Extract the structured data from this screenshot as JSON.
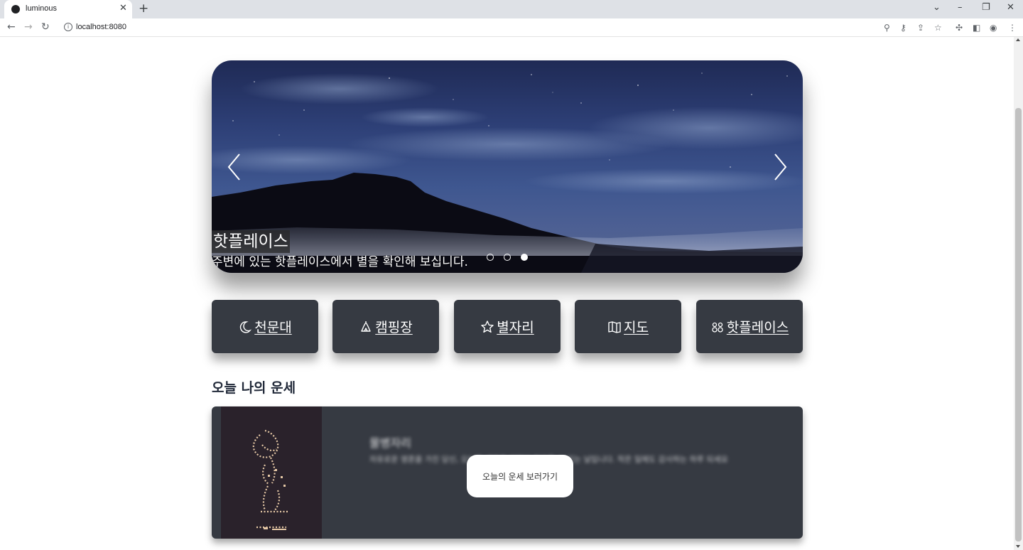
{
  "browser": {
    "tab_title": "luminous",
    "url": "localhost:8080",
    "tab_close": "✕",
    "new_tab": "+",
    "info_glyph": "i"
  },
  "carousel": {
    "caption_title": "핫플레이스",
    "caption_subtitle": "주변에 있는 핫플레이스에서 별을 확인해 보십니다.",
    "slide_count": 3,
    "active_slide": 3
  },
  "categories": [
    {
      "label": "천문대",
      "icon": "moon-icon"
    },
    {
      "label": "캠핑장",
      "icon": "tent-icon"
    },
    {
      "label": "별자리",
      "icon": "star-icon"
    },
    {
      "label": "지도",
      "icon": "map-icon"
    },
    {
      "label": "핫플레이스",
      "icon": "people-icon"
    }
  ],
  "fortune": {
    "section_title": "오늘 나의 운세",
    "sign_title": "물병자리",
    "sign_text": "자유로운 영혼을 가진 당신, 오늘은 새로운 인연이 찾아올 수 있는 날입니다. 작은 일에도 감사하는 하루 되세요",
    "button_label": "오늘의 운세 보러가기"
  },
  "colors": {
    "card_bg": "#363a42",
    "title_text": "#222a3a",
    "sky_top": "#1f2a55"
  }
}
